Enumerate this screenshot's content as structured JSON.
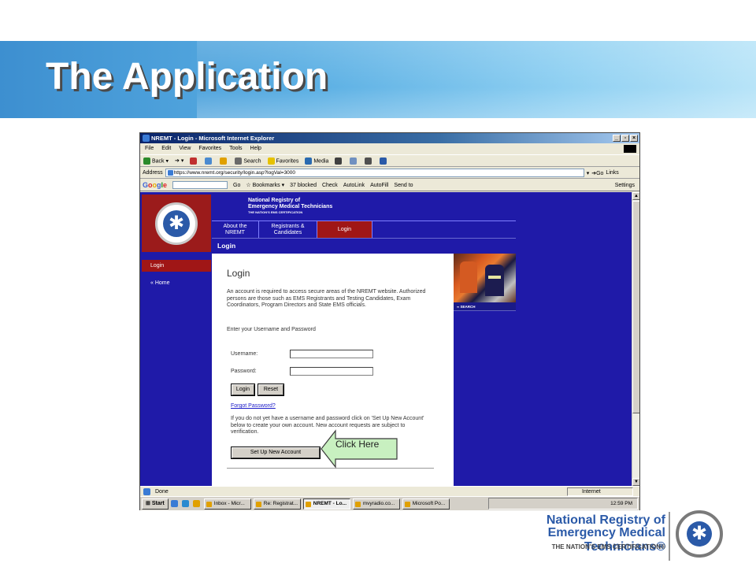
{
  "slide": {
    "title": "The Application"
  },
  "ie": {
    "window_title": "NREMT - Login - Microsoft Internet Explorer",
    "menu": [
      "File",
      "Edit",
      "View",
      "Favorites",
      "Tools",
      "Help"
    ],
    "toolbar": {
      "back": "Back",
      "search": "Search",
      "favorites": "Favorites",
      "media": "Media"
    },
    "address_label": "Address",
    "url": "https://www.nremt.org/security/login.asp?logVal=3000",
    "go": "Go",
    "links": "Links",
    "google": {
      "go": "Go",
      "bookmarks": "Bookmarks",
      "blocked": "37 blocked",
      "check": "Check",
      "autolink": "AutoLink",
      "autofill": "AutoFill",
      "send_to": "Send to",
      "settings": "Settings"
    },
    "status": "Done",
    "zone": "Internet"
  },
  "site": {
    "header_line1": "National Registry of",
    "header_line2": "Emergency Medical Technicians",
    "header_tagline": "THE NATION'S EMS CERTIFICATION",
    "nav": [
      {
        "line1": "About the",
        "line2": "NREMT"
      },
      {
        "line1": "Registrants &",
        "line2": "Candidates"
      },
      {
        "line1": "Login",
        "line2": ""
      }
    ],
    "band_title": "Login",
    "left_nav": {
      "login": "Login",
      "home": "« Home"
    },
    "search": "SEARCH",
    "content": {
      "title": "Login",
      "intro": "An account is required to access secure areas of the NREMT website. Authorized persons are those such as EMS Registrants and Testing Candidates, Exam Coordinators, Program Directors and State EMS officials.",
      "enter": "Enter your Username and Password",
      "username_label": "Username:",
      "password_label": "Password:",
      "username_value": "",
      "password_value": "",
      "login_button": "Login",
      "reset_button": "Reset",
      "forgot": "Forgot Password?",
      "new_account_text": "If you do not yet have a username and password click on 'Set Up New Account' below to create your own account. New account requests are subject to verification.",
      "setup_button": "Set Up New Account"
    }
  },
  "taskbar": {
    "start": "Start",
    "tasks": [
      "Inbox - Micr...",
      "Re: Registrat...",
      "NREMT - Lo...",
      "mvyradio.co...",
      "Microsoft Po..."
    ],
    "active_index": 2,
    "clock": "12:59 PM"
  },
  "callout": {
    "text": "Click Here"
  },
  "brand": {
    "line1": "National Registry of",
    "line2": "Emergency Medical Technicians®",
    "tagline": "THE NATION'S EMS CERTIFICATION®"
  }
}
